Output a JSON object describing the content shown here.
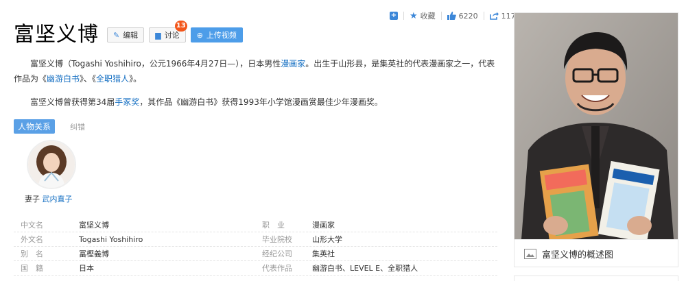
{
  "toolbar": {
    "favorite_label": "收藏",
    "like_count": "6220",
    "share_count": "117"
  },
  "title": "富坚义博",
  "buttons": {
    "edit": "编辑",
    "discuss": "讨论",
    "discuss_badge": "13",
    "upload_video": "上传视频"
  },
  "intro": {
    "p1_prefix": "富坚义博（Togashi Yoshihiro，公元1966年4月27日—），日本男性",
    "p1_link1": "漫画家",
    "p1_mid": "。出生于山形县，是集英社的代表漫画家之一，代表作品为《",
    "p1_link2": "幽游白书",
    "p1_mid2": "》、《",
    "p1_link3": "全职猎人",
    "p1_suffix": "》。",
    "p2_prefix": "富坚义博曾获得第34届",
    "p2_link": "手冢奖",
    "p2_suffix": "，其作品《幽游白书》获得1993年小学馆漫画赏最佳少年漫画奖。"
  },
  "tags": {
    "active": "人物关系",
    "other": "纠错"
  },
  "relation": {
    "role": "妻子",
    "name": "武内直子"
  },
  "info": [
    {
      "label": "中文名",
      "value": "富坚义博",
      "label2": "职　业",
      "value2": "漫画家"
    },
    {
      "label": "外文名",
      "value": "Togashi Yoshihiro",
      "label2": "毕业院校",
      "value2": "山形大学"
    },
    {
      "label": "别　名",
      "value": "冨樫義博",
      "label2": "经纪公司",
      "value2": "集英社"
    },
    {
      "label": "国　籍",
      "value": "日本",
      "label2": "代表作品",
      "value2": "幽游白书、LEVEL E、全职猎人"
    }
  ],
  "summary_pic": {
    "caption": "富坚义博的概述图"
  },
  "colors": {
    "accent": "#3c87d8",
    "link": "#136ec2",
    "badge": "#f3561a"
  }
}
